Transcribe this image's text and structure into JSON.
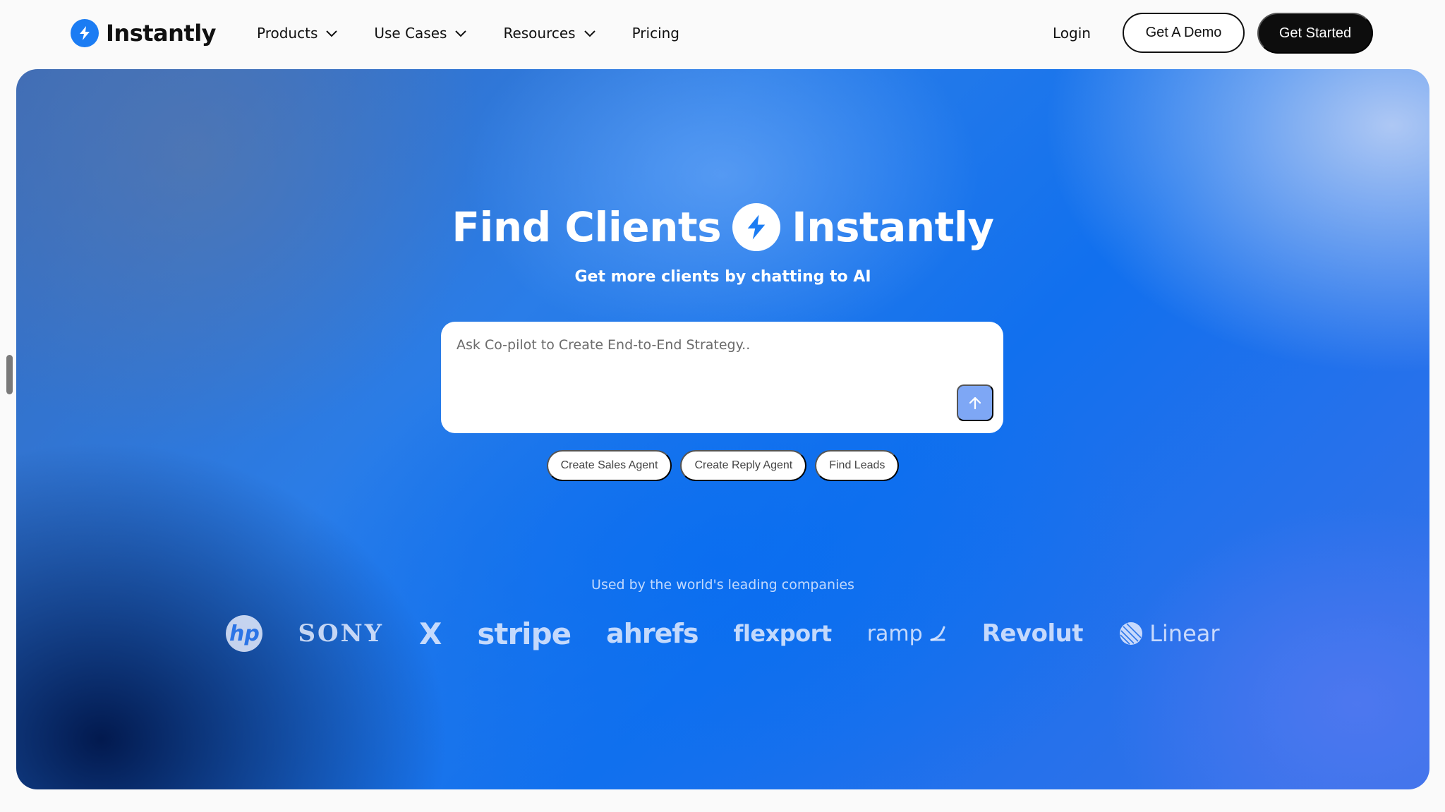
{
  "nav": {
    "brand": "Instantly",
    "brand_icon": "lightning-bolt-icon",
    "menu": [
      {
        "label": "Products",
        "has_dropdown": true
      },
      {
        "label": "Use Cases",
        "has_dropdown": true
      },
      {
        "label": "Resources",
        "has_dropdown": true
      },
      {
        "label": "Pricing",
        "has_dropdown": false
      }
    ],
    "login": "Login",
    "demo_button": "Get A Demo",
    "start_button": "Get Started"
  },
  "hero": {
    "title_left": "Find Clients",
    "title_right": "Instantly",
    "subtitle": "Get more clients by chatting to AI",
    "prompt_placeholder": "Ask Co-pilot to Create End-to-End Strategy..",
    "prompt_value": "",
    "send_icon": "arrow-up-icon",
    "chips": [
      "Create Sales Agent",
      "Create Reply Agent",
      "Find Leads"
    ],
    "used_by": "Used by the world's leading companies",
    "logos": {
      "hp": "hp",
      "sony": "SONY",
      "x": "X",
      "stripe": "stripe",
      "ahrefs": "ahrefs",
      "flexport": "flexport",
      "ramp": "ramp",
      "revolut": "Revolut",
      "linear": "Linear"
    }
  },
  "colors": {
    "accent": "#1b7cf3",
    "dark_button": "#0d0d0d",
    "send_button": "#7ea7f5"
  }
}
